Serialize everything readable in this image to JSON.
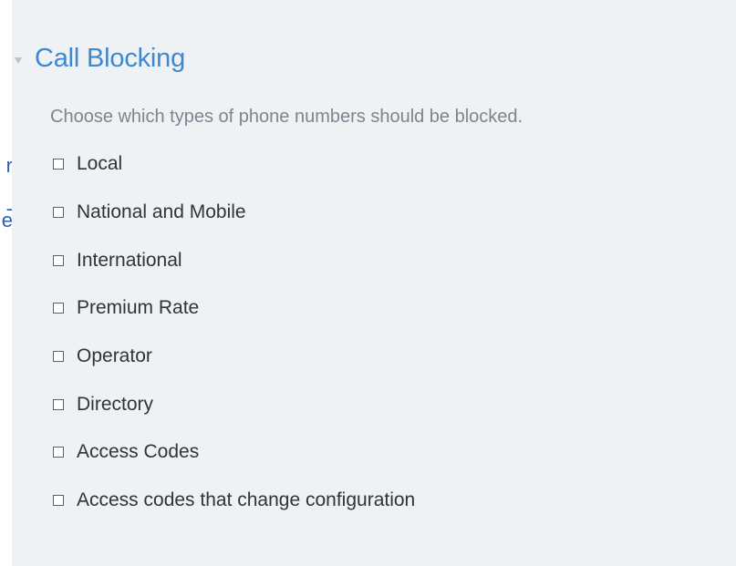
{
  "left_column_fragments": [
    "r",
    "-",
    "e"
  ],
  "section": {
    "title": "Call Blocking",
    "description": "Choose which types of phone numbers should be blocked.",
    "options": [
      {
        "label": "Local",
        "checked": false
      },
      {
        "label": "National and Mobile",
        "checked": false
      },
      {
        "label": "International",
        "checked": false
      },
      {
        "label": "Premium Rate",
        "checked": false
      },
      {
        "label": "Operator",
        "checked": false
      },
      {
        "label": "Directory",
        "checked": false
      },
      {
        "label": "Access Codes",
        "checked": false
      },
      {
        "label": "Access codes that change configuration",
        "checked": false
      }
    ]
  },
  "colors": {
    "panel_background": "#eff2f5",
    "title": "#3f87cf",
    "description": "#7b8590",
    "label": "#2f343a",
    "left_fragment": "#2d5fb8"
  }
}
